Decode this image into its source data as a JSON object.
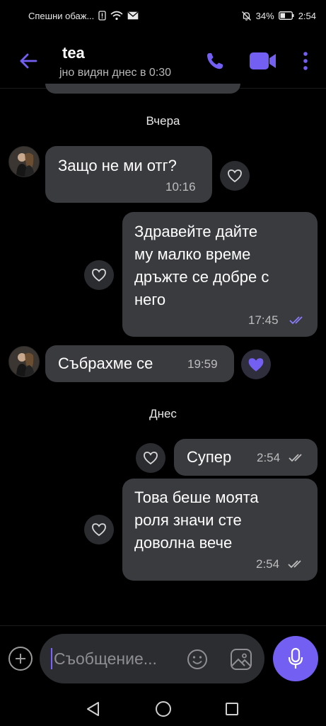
{
  "status_bar": {
    "carrier_text": "Спешни обаж...",
    "battery_percent": "34%",
    "time": "2:54"
  },
  "header": {
    "contact_name": "tea",
    "status_text": "јно видян днес в 0:30"
  },
  "chat": {
    "date_yesterday": "Вчера",
    "date_today": "Днес",
    "messages": [
      {
        "direction": "incoming",
        "text": "Защо не ми отг?",
        "time": "10:16",
        "liked": false
      },
      {
        "direction": "outgoing",
        "lines": [
          "Здравейте дайте",
          "му малко време",
          "дръжте се добре с",
          "него"
        ],
        "time": "17:45",
        "status": "read",
        "liked": false
      },
      {
        "direction": "incoming",
        "text": "Събрахме се",
        "time": "19:59",
        "liked": true
      },
      {
        "direction": "outgoing",
        "text": "Супер",
        "time": "2:54",
        "status": "delivered",
        "liked": false
      },
      {
        "direction": "outgoing",
        "lines": [
          "Това беше моята",
          "роля значи сте",
          "доволна вече"
        ],
        "time": "2:54",
        "status": "delivered",
        "liked": false
      }
    ]
  },
  "composer": {
    "placeholder": "Съобщение..."
  },
  "icons": {
    "back": "arrow-left-icon",
    "call": "phone-icon",
    "video": "video-camera-icon",
    "more": "more-vertical-icon",
    "like": "heart-icon",
    "plus": "plus-icon",
    "emoji": "smiley-icon",
    "gallery": "image-icon",
    "mic": "microphone-icon"
  },
  "colors": {
    "accent": "#7360f2",
    "bubble": "#3a3b3f",
    "background": "#000000",
    "read_checks": "#8a7cf5",
    "delivered_checks": "#bdbdbd"
  }
}
